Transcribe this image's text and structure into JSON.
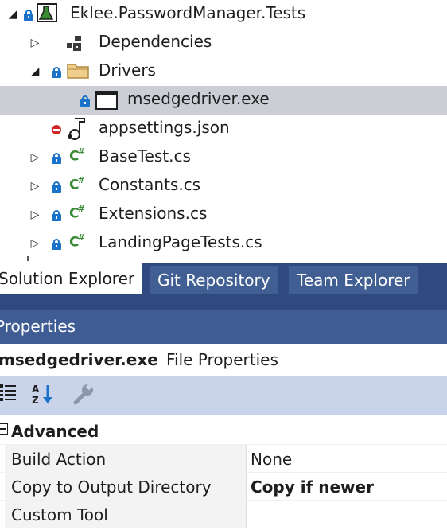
{
  "solution_explorer": {
    "items": [
      {
        "label": "Eklee.PasswordManager.Tests",
        "icon": "test-project-icon",
        "expanded": true,
        "status": "locked"
      },
      {
        "label": "Dependencies",
        "icon": "dependencies-icon",
        "expanded": false
      },
      {
        "label": "Drivers",
        "icon": "folder-icon",
        "expanded": true,
        "status": "locked"
      },
      {
        "label": "msedgedriver.exe",
        "icon": "exe-file-icon",
        "status": "locked",
        "selected": true
      },
      {
        "label": "appsettings.json",
        "icon": "json-file-icon",
        "status": "excluded"
      },
      {
        "label": "BaseTest.cs",
        "icon": "csharp-file-icon",
        "expanded": false,
        "status": "locked"
      },
      {
        "label": "Constants.cs",
        "icon": "csharp-file-icon",
        "expanded": false,
        "status": "locked"
      },
      {
        "label": "Extensions.cs",
        "icon": "csharp-file-icon",
        "expanded": false,
        "status": "locked"
      },
      {
        "label": "LandingPageTests.cs",
        "icon": "csharp-file-icon",
        "expanded": false,
        "status": "locked"
      }
    ]
  },
  "tabs": [
    {
      "label": "Solution Explorer",
      "active": true
    },
    {
      "label": "Git Repository",
      "active": false
    },
    {
      "label": "Team Explorer",
      "active": false
    }
  ],
  "properties": {
    "title": "Properties",
    "object_name": "msedgedriver.exe",
    "object_type": "File Properties",
    "toolbar": {
      "categorized": "categorized-icon",
      "alphabetical": "alphabetical-sort-icon",
      "property_pages": "wrench-icon"
    },
    "category": "Advanced",
    "rows": [
      {
        "name": "Build Action",
        "value": "None",
        "bold": false
      },
      {
        "name": "Copy to Output Directory",
        "value": "Copy if newer",
        "bold": true
      },
      {
        "name": "Custom Tool",
        "value": "",
        "bold": false
      }
    ]
  },
  "colors": {
    "tab_bar": "#2e4a7e",
    "tab_inactive": "#415f93",
    "title_bar": "#3f5d94",
    "toolbar": "#c9d4ea",
    "selection": "#ccced6",
    "lock_blue": "#1a73c8",
    "csharp_green": "#388a34",
    "excluded_red": "#d12727"
  }
}
